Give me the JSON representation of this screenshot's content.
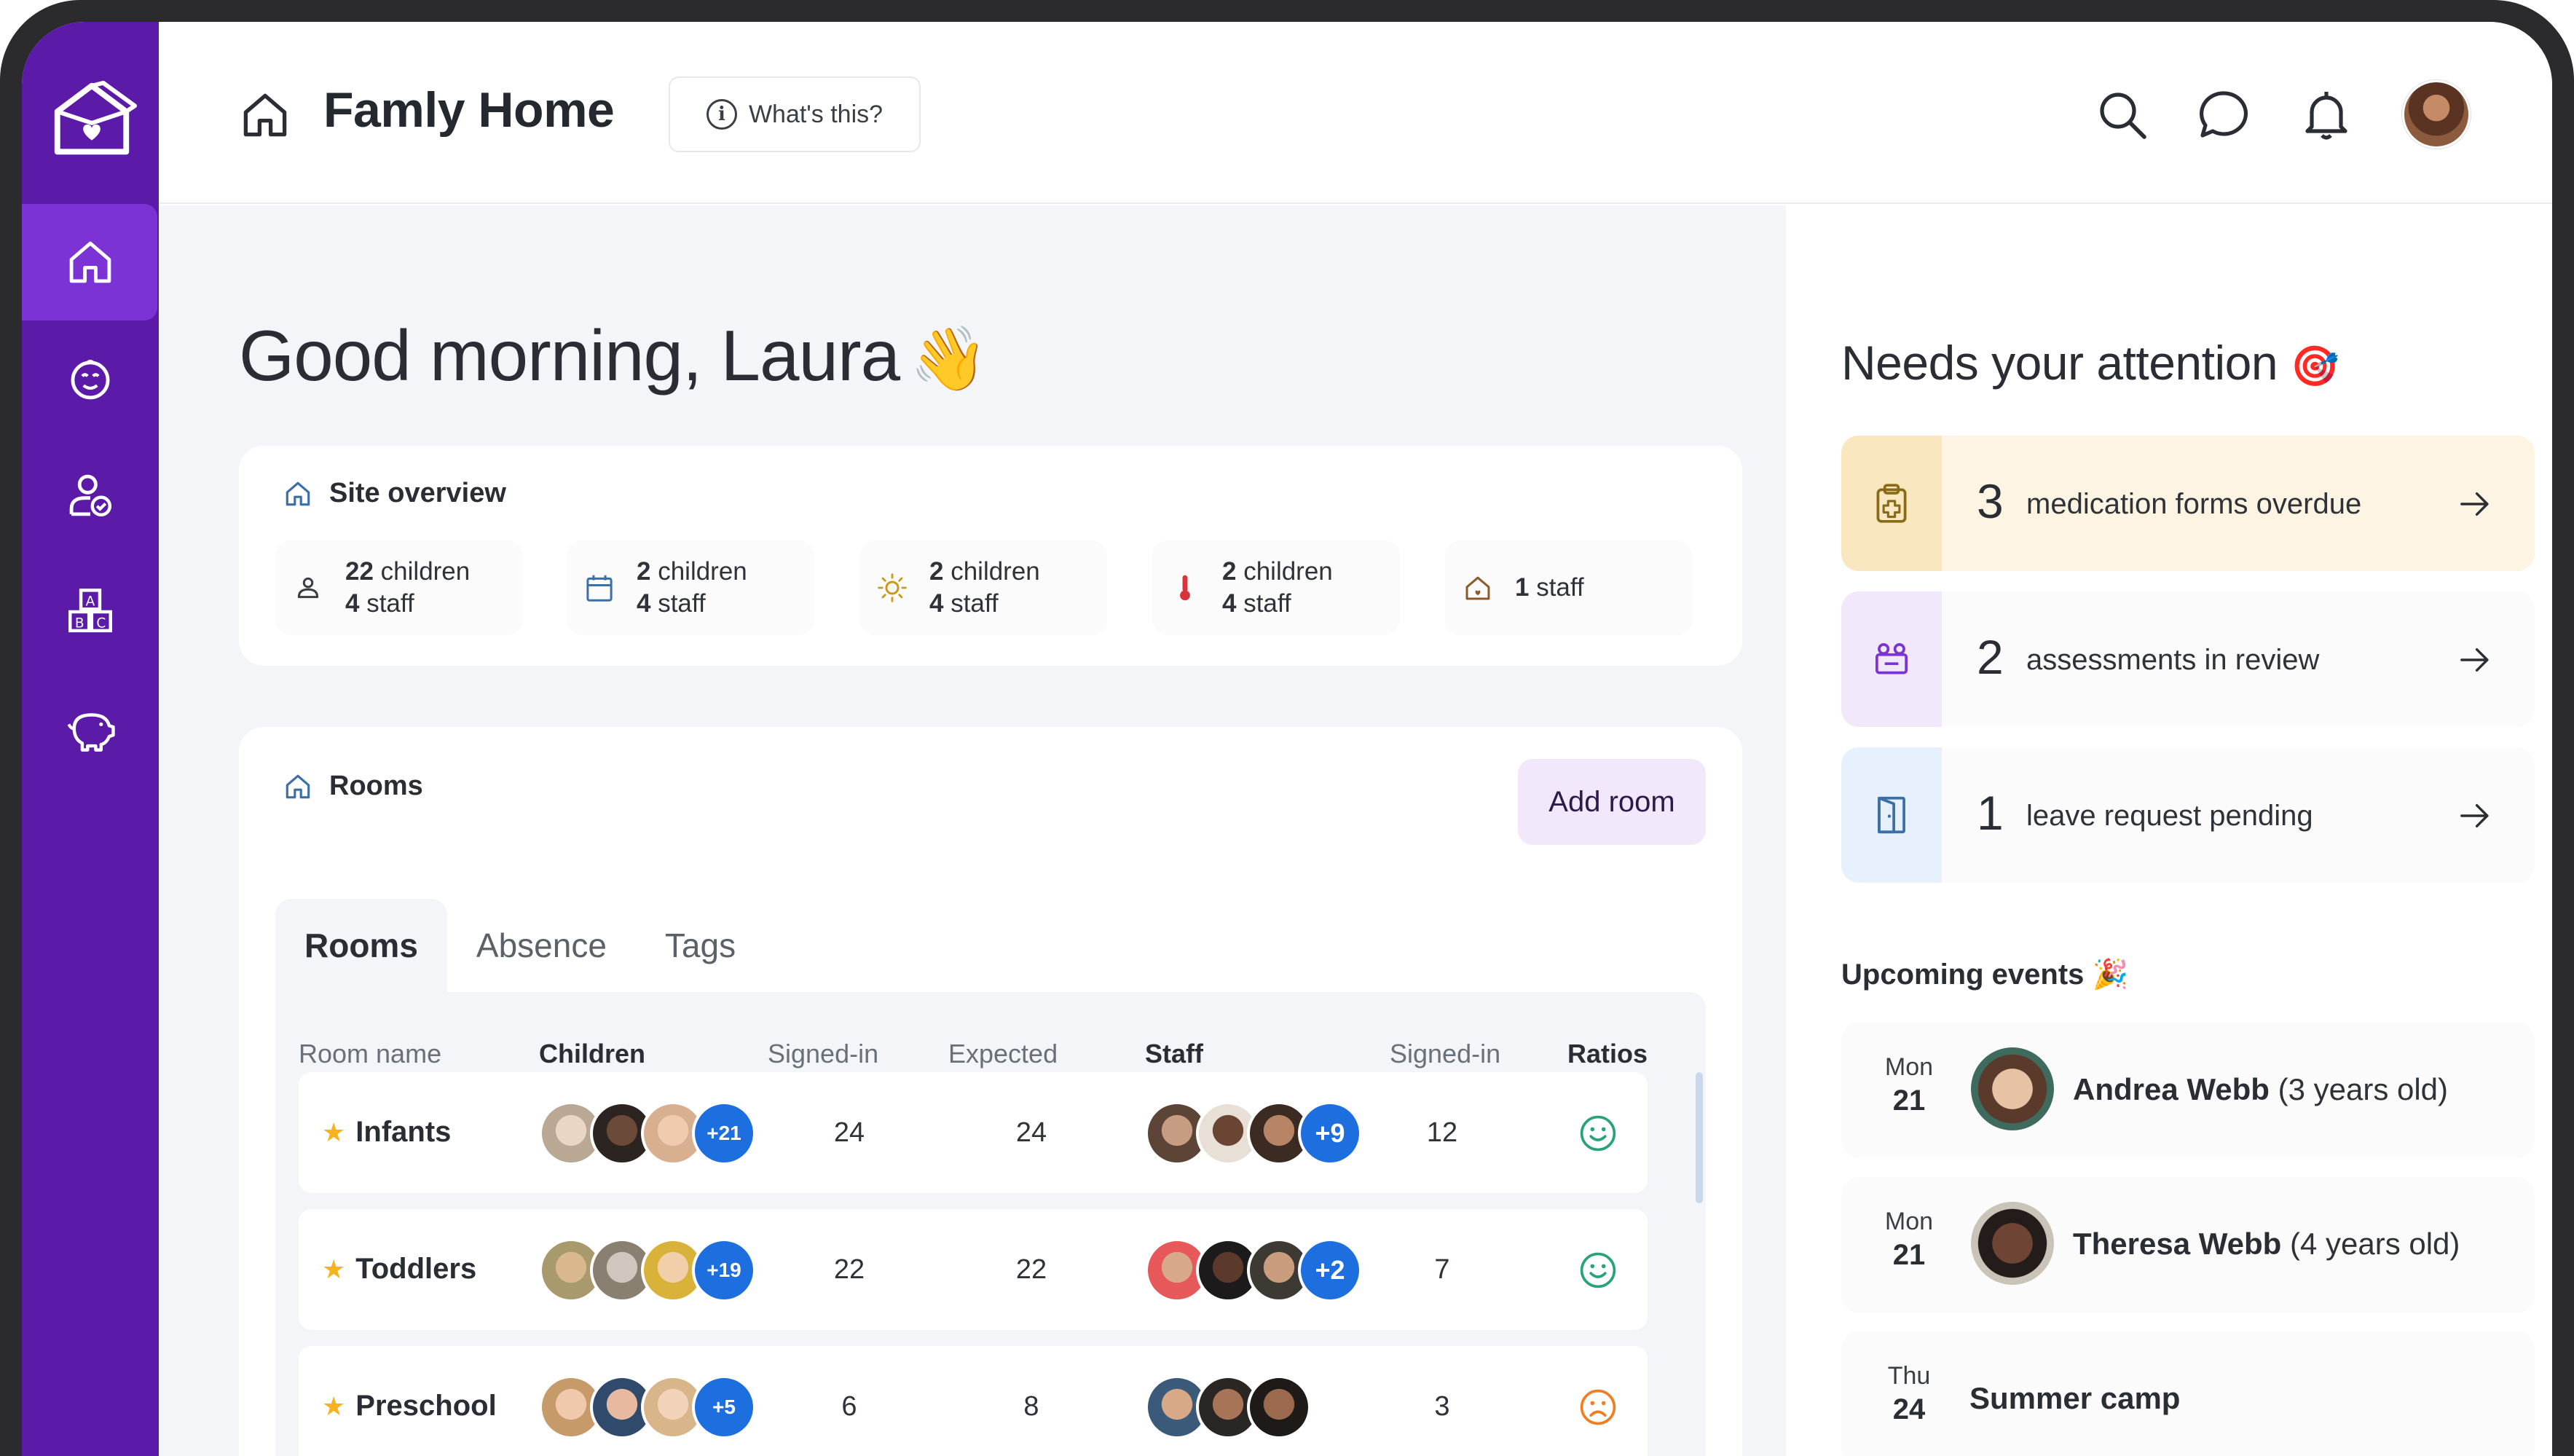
{
  "header": {
    "title": "Famly Home",
    "whats_this": "What's this?"
  },
  "greeting": {
    "text": "Good morning, Laura",
    "emoji": "👋"
  },
  "site_overview": {
    "title": "Site overview",
    "stats": [
      {
        "icon": "person-icon",
        "children": "22",
        "children_label": "children",
        "staff": "4",
        "staff_label": "staff"
      },
      {
        "icon": "calendar-icon",
        "children": "2",
        "children_label": "children",
        "staff": "4",
        "staff_label": "staff"
      },
      {
        "icon": "sun-icon",
        "children": "2",
        "children_label": "children",
        "staff": "4",
        "staff_label": "staff"
      },
      {
        "icon": "thermometer-icon",
        "children": "2",
        "children_label": "children",
        "staff": "4",
        "staff_label": "staff"
      },
      {
        "icon": "house-icon",
        "staff": "1",
        "staff_label": "staff"
      }
    ]
  },
  "rooms": {
    "title": "Rooms",
    "add_room": "Add room",
    "tabs": [
      "Rooms",
      "Absence",
      "Tags"
    ],
    "columns": [
      "Room name",
      "Children",
      "Signed-in",
      "Expected",
      "Staff",
      "Signed-in",
      "Ratios"
    ],
    "rows": [
      {
        "name": "Infants",
        "children_more": "+21",
        "children_signed_in": "24",
        "expected": "24",
        "staff_more": "+9",
        "staff_signed_in": "12",
        "ratio": "happy"
      },
      {
        "name": "Toddlers",
        "children_more": "+19",
        "children_signed_in": "22",
        "expected": "22",
        "staff_more": "+2",
        "staff_signed_in": "7",
        "ratio": "happy"
      },
      {
        "name": "Preschool",
        "children_more": "+5",
        "children_signed_in": "6",
        "expected": "8",
        "staff_more": "",
        "staff_signed_in": "3",
        "ratio": "sad"
      }
    ]
  },
  "attention": {
    "title": "Needs your attention",
    "emoji": "🎯",
    "items": [
      {
        "count": "3",
        "label": "medication forms overdue",
        "icon": "medical-clipboard-icon",
        "color": "#fdf4e3"
      },
      {
        "count": "2",
        "label": "assessments in review",
        "icon": "blocks-icon",
        "color": "#f1e9fb"
      },
      {
        "count": "1",
        "label": "leave request pending",
        "icon": "door-icon",
        "color": "#e7f1fd"
      }
    ]
  },
  "events": {
    "title": "Upcoming events",
    "emoji": "🎉",
    "items": [
      {
        "day": "Mon",
        "date": "21",
        "name": "Andrea Webb",
        "detail": "(3 years old)"
      },
      {
        "day": "Mon",
        "date": "21",
        "name": "Theresa Webb",
        "detail": "(4 years old)"
      },
      {
        "day": "Thu",
        "date": "24",
        "name": "Summer camp",
        "detail": ""
      }
    ]
  },
  "colors": {
    "sidebar": "#5b1aa8",
    "sidebar_active": "#7c33d6",
    "accent_blue": "#1d6fdf",
    "happy": "#27a27a",
    "sad": "#ef7d22"
  }
}
